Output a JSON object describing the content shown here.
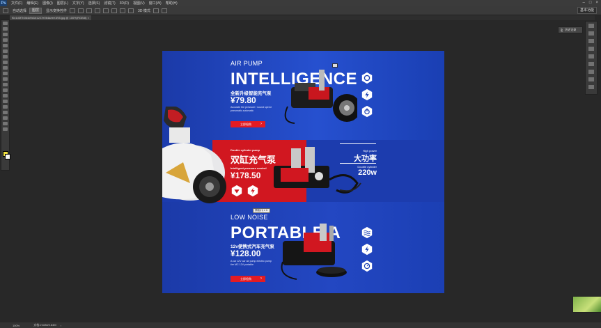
{
  "app": {
    "logo": "Ps"
  },
  "menus": [
    "文件(F)",
    "编辑(E)",
    "图像(I)",
    "图层(L)",
    "文字(Y)",
    "选择(S)",
    "滤镜(T)",
    "3D(D)",
    "视图(V)",
    "窗口(W)",
    "帮助(H)"
  ],
  "options": {
    "auto_select": "自动选择",
    "layer_value": "图层",
    "show_transform": "显示变换控件",
    "mode_3d": "3D 模式"
  },
  "workspace": {
    "label": "基本功能"
  },
  "document": {
    "tab": "f0c1d3f7b0d4d9d1b1227e0b4aeee1f55.jpg @ 100%(RGB/8) ×"
  },
  "history_panel": {
    "label": "历史记录"
  },
  "status": {
    "zoom": "100%",
    "doc": "文档:2.64M/2.64M"
  },
  "canvas": {
    "section1": {
      "sub": "AIR PUMP",
      "title": "INTELLIGENCE",
      "cn": "全新升级智能充气泵",
      "price_symbol": "¥",
      "price": "79.80",
      "desc1": "Accurate tire pressure / sound speed",
      "desc2": "pneumatic automatic",
      "button": "立即抢购"
    },
    "section2": {
      "label": "Double cylinder pump",
      "cn_title": "双缸充气泵",
      "sub": "Intelligent pressure control",
      "price_symbol": "¥",
      "price": "178.50",
      "right_small1": "High power",
      "right_cn": "大功率",
      "right_small2": "Double cylinder",
      "right_watt": "220w"
    },
    "section3": {
      "sub": "LOW NOISE",
      "title": "PORTABLE A",
      "cn": "12v便携式汽车充气泵",
      "price_symbol": "¥",
      "price": "128.00",
      "desc1": "A car 12V car air pump electric pump",
      "desc2": "tire MC 12V portable",
      "button": "立即抢购"
    },
    "chip_label": "抓取(H) ± 0:",
    "colors": {
      "background": "#1a3fb3",
      "accent_red": "#d11720",
      "button_red": "#e31b23"
    }
  }
}
